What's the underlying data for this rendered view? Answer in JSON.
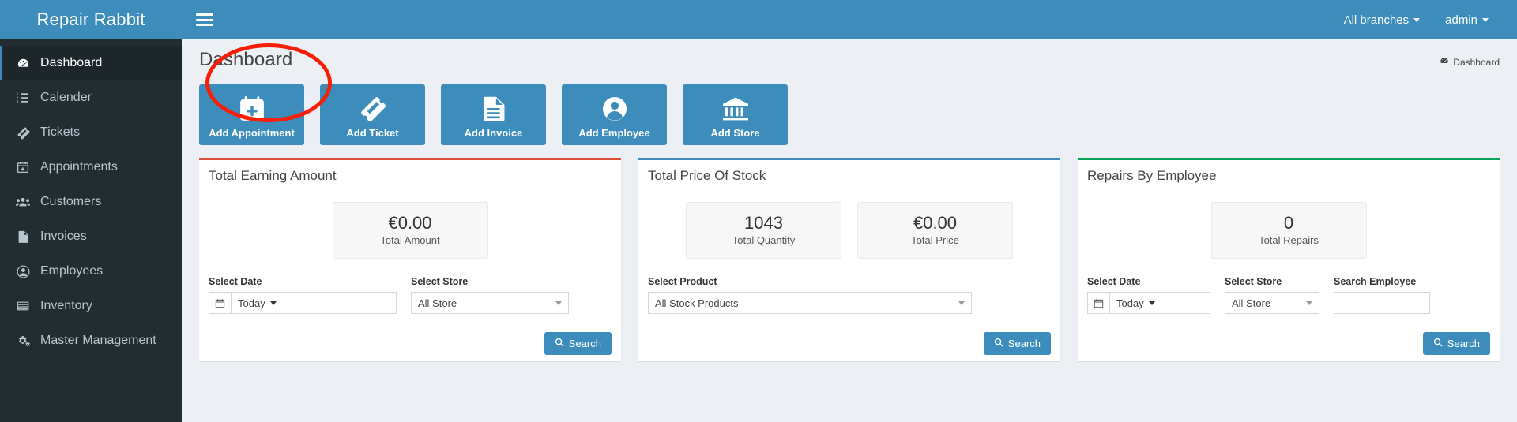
{
  "brand": {
    "title": "Repair Rabbit"
  },
  "topbar": {
    "menu_toggle": "hamburger-icon",
    "branches_label": "All branches",
    "user_label": "admin"
  },
  "sidebar": {
    "items": [
      {
        "label": "Dashboard",
        "icon": "dashboard-icon",
        "active": true
      },
      {
        "label": "Calender",
        "icon": "list-icon",
        "active": false
      },
      {
        "label": "Tickets",
        "icon": "ticket-icon",
        "active": false
      },
      {
        "label": "Appointments",
        "icon": "calendar-plus-icon",
        "active": false
      },
      {
        "label": "Customers",
        "icon": "users-icon",
        "active": false
      },
      {
        "label": "Invoices",
        "icon": "file-text-icon",
        "active": false
      },
      {
        "label": "Employees",
        "icon": "user-circle-icon",
        "active": false
      },
      {
        "label": "Inventory",
        "icon": "table-icon",
        "active": false
      },
      {
        "label": "Master Management",
        "icon": "gears-icon",
        "active": false
      }
    ]
  },
  "page": {
    "title": "Dashboard",
    "breadcrumb": "Dashboard",
    "breadcrumb_icon": "dashboard-icon"
  },
  "tiles": [
    {
      "label": "Add Appointment",
      "icon": "calendar-plus-icon",
      "highlighted": true
    },
    {
      "label": "Add Ticket",
      "icon": "ticket-icon",
      "highlighted": false
    },
    {
      "label": "Add Invoice",
      "icon": "file-text-icon",
      "highlighted": false
    },
    {
      "label": "Add Employee",
      "icon": "user-circle-icon",
      "highlighted": false
    },
    {
      "label": "Add Store",
      "icon": "bank-icon",
      "highlighted": false
    }
  ],
  "panels": {
    "earning": {
      "title": "Total Earning Amount",
      "accent": "#dd4b39",
      "stats": [
        {
          "value": "€0.00",
          "label": "Total Amount"
        }
      ],
      "date_label": "Select Date",
      "date_value": "Today",
      "store_label": "Select Store",
      "store_value": "All Store",
      "search_label": "Search"
    },
    "stock": {
      "title": "Total Price Of Stock",
      "accent": "#3c8dbc",
      "stats": [
        {
          "value": "1043",
          "label": "Total Quantity"
        },
        {
          "value": "€0.00",
          "label": "Total Price"
        }
      ],
      "product_label": "Select Product",
      "product_value": "All Stock Products",
      "search_label": "Search"
    },
    "repairs": {
      "title": "Repairs By Employee",
      "accent": "#00a65a",
      "stats": [
        {
          "value": "0",
          "label": "Total Repairs"
        }
      ],
      "date_label": "Select Date",
      "date_value": "Today",
      "store_label": "Select Store",
      "store_value": "All Store",
      "employee_label": "Search Employee",
      "employee_value": "",
      "employee_placeholder": "",
      "search_label": "Search"
    }
  },
  "colors": {
    "brand_blue": "#3c8dbc",
    "sidebar_dark": "#222d32",
    "accent_red": "#dd4b39",
    "accent_green": "#00a65a",
    "annotation_red": "#f81f06"
  }
}
